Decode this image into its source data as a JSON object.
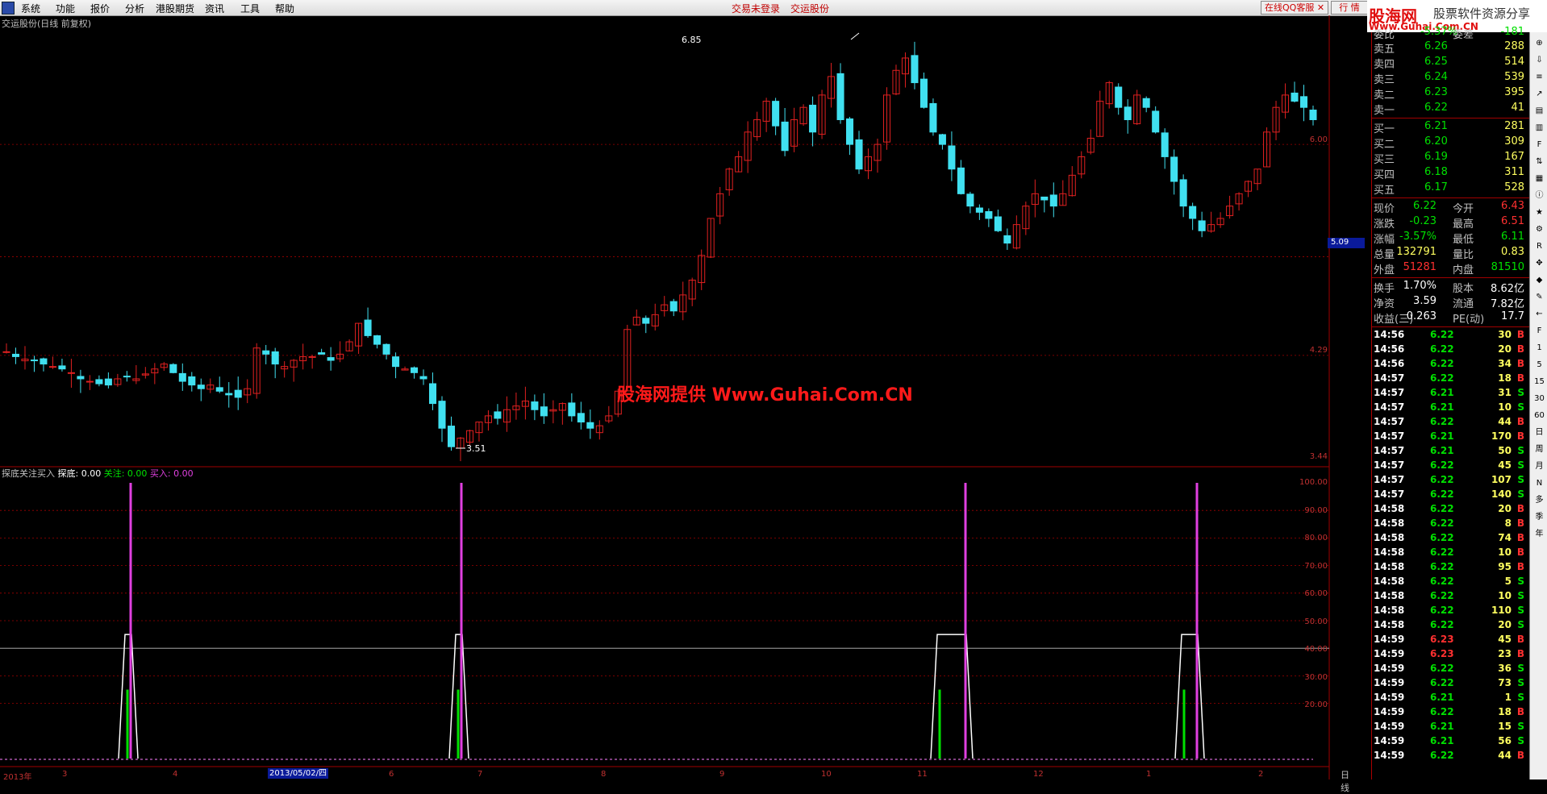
{
  "menu": {
    "items": [
      "系统",
      "功能",
      "报价",
      "分析",
      "港股期货",
      "资讯",
      "工具",
      "帮助"
    ],
    "status_login": "交易未登录",
    "status_stock": "交运股份",
    "qq_service": "在线QQ客服",
    "quote_tab": "行 情"
  },
  "brand": {
    "logo": "股海网",
    "tagline": "股票软件资源分享",
    "url": "Www.Guhai.Com.CN"
  },
  "chart": {
    "title": "交运股份(日线 前复权)",
    "watermark": "股海网提供 Www.Guhai.Com.CN",
    "high_label": "6.85",
    "low_label": "3.51",
    "current_price_box": "5.09",
    "price_axis": [
      "6.00",
      "4.29",
      "3.44"
    ],
    "date_axis": [
      "2013年",
      "3",
      "4",
      "2013/05/02/四",
      "6",
      "7",
      "8",
      "9",
      "10",
      "11",
      "12",
      "1",
      "2"
    ],
    "period_label": "日线",
    "indicator": {
      "name": "探底关注买入",
      "labels": [
        {
          "text": "探底: 0.00",
          "color": "#ffffff"
        },
        {
          "text": "关注: 0.00",
          "color": "#00e000"
        },
        {
          "text": "买入: 0.00",
          "color": "#e040e0"
        }
      ],
      "axis": [
        "100.00",
        "90.00",
        "80.00",
        "70.00",
        "60.00",
        "50.00",
        "40.00",
        "30.00",
        "20.00"
      ]
    },
    "colors": {
      "up": "#e02020",
      "down": "#40e0f0",
      "buy": "#e040e0",
      "watch": "#00e000",
      "bottom": "#ffffff",
      "axis": "#a00000"
    }
  },
  "chart_data": [
    {
      "type": "candlestick",
      "title": "交运股份(日线 前复权)",
      "ylim": [
        3.44,
        6.85
      ],
      "yticks": [
        6.0,
        5.09,
        4.29,
        3.44
      ],
      "annotations": [
        {
          "label": "6.85",
          "type": "high"
        },
        {
          "label": "3.51",
          "type": "low"
        }
      ],
      "close_approx": [
        4.32,
        4.28,
        4.26,
        4.25,
        4.22,
        4.2,
        4.18,
        4.15,
        4.1,
        4.08,
        4.06,
        4.05,
        4.1,
        4.12,
        4.1,
        4.14,
        4.18,
        4.22,
        4.15,
        4.08,
        4.05,
        4.02,
        4.05,
        4.0,
        3.97,
        3.95,
        4.02,
        4.35,
        4.3,
        4.22,
        4.2,
        4.25,
        4.28,
        4.28,
        4.3,
        4.25,
        4.3,
        4.4,
        4.55,
        4.45,
        4.38,
        4.3,
        4.2,
        4.18,
        4.15,
        4.1,
        3.9,
        3.7,
        3.55,
        3.62,
        3.68,
        3.75,
        3.8,
        3.78,
        3.85,
        3.88,
        3.92,
        3.85,
        3.8,
        3.85,
        3.9,
        3.8,
        3.75,
        3.7,
        3.72,
        3.8,
        4.0,
        4.5,
        4.6,
        4.55,
        4.62,
        4.7,
        4.65,
        4.78,
        4.9,
        5.1,
        5.4,
        5.6,
        5.8,
        5.9,
        6.1,
        6.2,
        6.35,
        6.15,
        5.95,
        6.2,
        6.3,
        6.1,
        6.4,
        6.55,
        6.2,
        6.0,
        5.8,
        5.9,
        6.0,
        6.4,
        6.6,
        6.7,
        6.5,
        6.3,
        6.1,
        6.0,
        5.8,
        5.6,
        5.5,
        5.45,
        5.4,
        5.3,
        5.2,
        5.35,
        5.5,
        5.6,
        5.55,
        5.5,
        5.6,
        5.75,
        5.9,
        6.05,
        6.35,
        6.5,
        6.3,
        6.2,
        6.4,
        6.3,
        6.1,
        5.9,
        5.7,
        5.5,
        5.4,
        5.3,
        5.35,
        5.4,
        5.5,
        5.6,
        5.7,
        5.8,
        6.1,
        6.3,
        6.4,
        6.35,
        6.3,
        6.2
      ]
    },
    {
      "type": "line",
      "title": "探底关注买入",
      "ylim": [
        0,
        100
      ],
      "series": [
        {
          "name": "探底",
          "events": [
            {
              "x": "2013-03",
              "value": 45
            },
            {
              "x": "2013-06",
              "value": 45
            },
            {
              "x": "2013-11",
              "value": 45
            },
            {
              "x": "2014-01",
              "value": 45
            }
          ]
        },
        {
          "name": "关注",
          "events": [
            {
              "x": "2013-03",
              "value": 25
            },
            {
              "x": "2013-06",
              "value": 25
            },
            {
              "x": "2013-11",
              "value": 25
            },
            {
              "x": "2014-01",
              "value": 25
            }
          ]
        },
        {
          "name": "买入",
          "events": [
            {
              "x": "2013-03",
              "value": 100
            },
            {
              "x": "2013-06",
              "value": 100
            },
            {
              "x": "2013-11",
              "value": 100
            },
            {
              "x": "2014-01",
              "value": 100
            }
          ]
        }
      ],
      "current": {
        "探底": 0.0,
        "关注": 0.0,
        "买入": 0.0
      }
    }
  ],
  "quote": {
    "top_cut": [
      "委比",
      "-5.37%",
      "委差",
      "-181"
    ],
    "sells": [
      {
        "label": "卖五",
        "price": "6.26",
        "vol": "288"
      },
      {
        "label": "卖四",
        "price": "6.25",
        "vol": "514"
      },
      {
        "label": "卖三",
        "price": "6.24",
        "vol": "539"
      },
      {
        "label": "卖二",
        "price": "6.23",
        "vol": "395"
      },
      {
        "label": "卖一",
        "price": "6.22",
        "vol": "41"
      }
    ],
    "buys": [
      {
        "label": "买一",
        "price": "6.21",
        "vol": "281"
      },
      {
        "label": "买二",
        "price": "6.20",
        "vol": "309"
      },
      {
        "label": "买三",
        "price": "6.19",
        "vol": "167"
      },
      {
        "label": "买四",
        "price": "6.18",
        "vol": "311"
      },
      {
        "label": "买五",
        "price": "6.17",
        "vol": "528"
      }
    ],
    "stats": [
      {
        "l1": "现价",
        "v1": "6.22",
        "c1": "#00e000",
        "l2": "今开",
        "v2": "6.43",
        "c2": "#ff3030"
      },
      {
        "l1": "涨跌",
        "v1": "-0.23",
        "c1": "#00e000",
        "l2": "最高",
        "v2": "6.51",
        "c2": "#ff3030"
      },
      {
        "l1": "涨幅",
        "v1": "-3.57%",
        "c1": "#00e000",
        "l2": "最低",
        "v2": "6.11",
        "c2": "#00e000"
      },
      {
        "l1": "总量",
        "v1": "132791",
        "c1": "#ffff60",
        "l2": "量比",
        "v2": "0.83",
        "c2": "#ffff60"
      },
      {
        "l1": "外盘",
        "v1": "51281",
        "c1": "#ff3030",
        "l2": "内盘",
        "v2": "81510",
        "c2": "#00e000"
      }
    ],
    "fund": [
      {
        "l1": "换手",
        "v1": "1.70%",
        "l2": "股本",
        "v2": "8.62亿"
      },
      {
        "l1": "净资",
        "v1": "3.59",
        "l2": "流通",
        "v2": "7.82亿"
      },
      {
        "l1": "收益(三)",
        "v1": "0.263",
        "l2": "PE(动)",
        "v2": "17.7"
      }
    ],
    "ticks": [
      [
        "14:56",
        "6.22",
        "30",
        "B"
      ],
      [
        "14:56",
        "6.22",
        "20",
        "B"
      ],
      [
        "14:56",
        "6.22",
        "34",
        "B"
      ],
      [
        "14:57",
        "6.22",
        "18",
        "B"
      ],
      [
        "14:57",
        "6.21",
        "31",
        "S"
      ],
      [
        "14:57",
        "6.21",
        "10",
        "S"
      ],
      [
        "14:57",
        "6.22",
        "44",
        "B"
      ],
      [
        "14:57",
        "6.21",
        "170",
        "B"
      ],
      [
        "14:57",
        "6.21",
        "50",
        "S"
      ],
      [
        "14:57",
        "6.22",
        "45",
        "S"
      ],
      [
        "14:57",
        "6.22",
        "107",
        "S"
      ],
      [
        "14:57",
        "6.22",
        "140",
        "S"
      ],
      [
        "14:58",
        "6.22",
        "20",
        "B"
      ],
      [
        "14:58",
        "6.22",
        "8",
        "B"
      ],
      [
        "14:58",
        "6.22",
        "74",
        "B"
      ],
      [
        "14:58",
        "6.22",
        "10",
        "B"
      ],
      [
        "14:58",
        "6.22",
        "95",
        "B"
      ],
      [
        "14:58",
        "6.22",
        "5",
        "S"
      ],
      [
        "14:58",
        "6.22",
        "10",
        "S"
      ],
      [
        "14:58",
        "6.22",
        "110",
        "S"
      ],
      [
        "14:58",
        "6.22",
        "20",
        "S"
      ],
      [
        "14:59",
        "6.23",
        "45",
        "B"
      ],
      [
        "14:59",
        "6.23",
        "23",
        "B"
      ],
      [
        "14:59",
        "6.22",
        "36",
        "S"
      ],
      [
        "14:59",
        "6.22",
        "73",
        "S"
      ],
      [
        "14:59",
        "6.21",
        "1",
        "S"
      ],
      [
        "14:59",
        "6.22",
        "18",
        "B"
      ],
      [
        "14:59",
        "6.21",
        "15",
        "S"
      ],
      [
        "14:59",
        "6.21",
        "56",
        "S"
      ],
      [
        "14:59",
        "6.22",
        "44",
        "B"
      ]
    ]
  },
  "tools": [
    "1",
    "5",
    "15",
    "30",
    "60",
    "日",
    "周",
    "月",
    "N",
    "多",
    "季",
    "年"
  ]
}
